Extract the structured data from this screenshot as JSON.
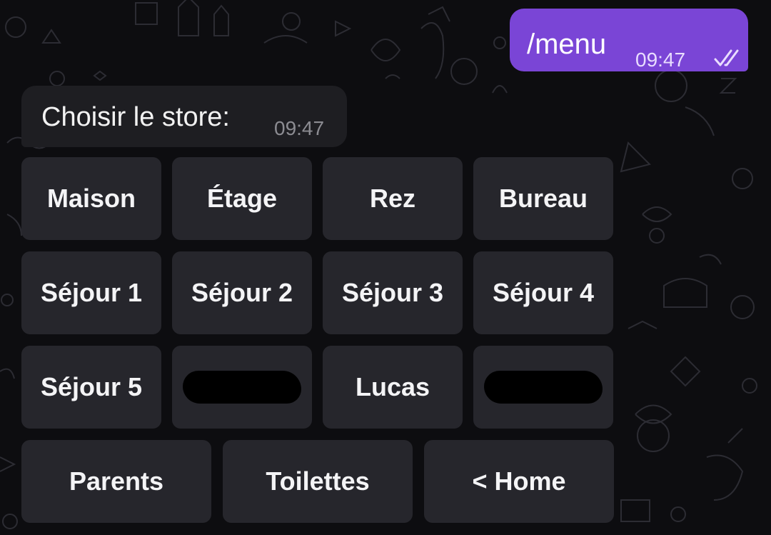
{
  "messages": {
    "outgoing": {
      "text": "/menu",
      "time": "09:47",
      "status_icon": "double-check-icon"
    },
    "incoming": {
      "text": "Choisir le store:",
      "time": "09:47"
    }
  },
  "keyboard": {
    "row1": [
      "Maison",
      "Étage",
      "Rez",
      "Bureau"
    ],
    "row2": [
      "Séjour 1",
      "Séjour 2",
      "Séjour 3",
      "Séjour 4"
    ],
    "row3": [
      "Séjour 5",
      "",
      "Lucas",
      ""
    ],
    "row4": [
      "Parents",
      "Toilettes",
      "< Home"
    ]
  },
  "colors": {
    "background": "#0d0d10",
    "outgoing_bubble": "#7a45d6",
    "incoming_bubble": "#1e1e22",
    "button": "#28282e",
    "text": "#f4f4f6"
  }
}
